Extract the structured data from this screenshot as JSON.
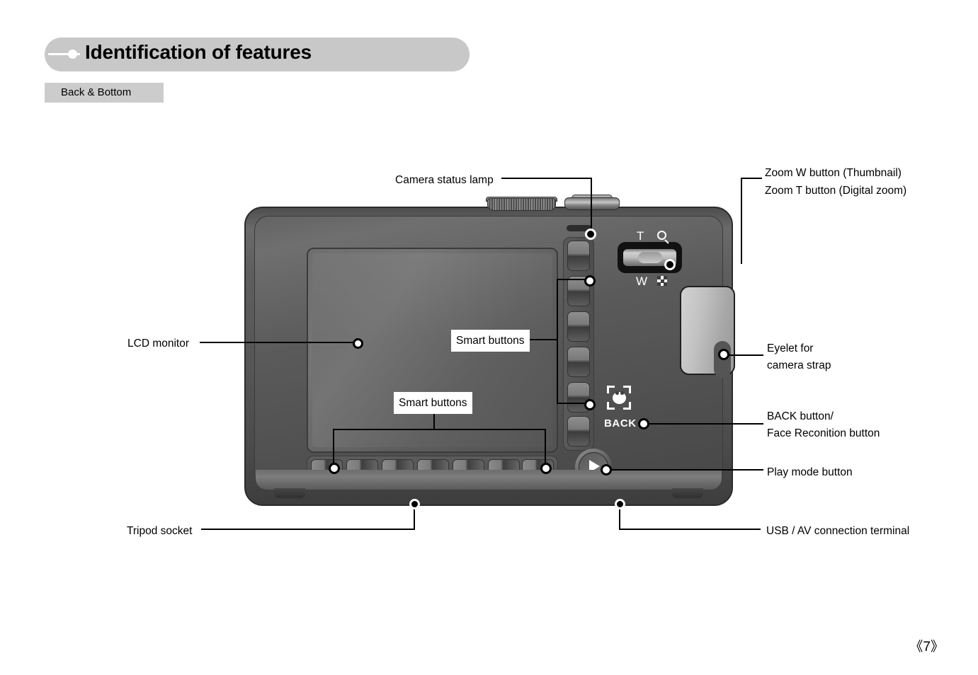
{
  "header": {
    "title": "Identification of features",
    "subtab": "Back & Bottom"
  },
  "callouts": {
    "camera_status_lamp": "Camera status lamp",
    "zoom_w": "Zoom W button (Thumbnail)",
    "zoom_t": "Zoom T button (Digital zoom)",
    "lcd_monitor": "LCD monitor",
    "smart_buttons_right": "Smart buttons",
    "smart_buttons_bottom": "Smart buttons",
    "eyelet_line1": "Eyelet for",
    "eyelet_line2": "camera strap",
    "back_button_line1": "BACK button/",
    "back_button_line2": "Face Reconition button",
    "play_mode_button": "Play mode button",
    "tripod_socket": "Tripod socket",
    "usb_av": "USB / AV connection terminal"
  },
  "camera_markings": {
    "zoom_t": "T",
    "zoom_w": "W",
    "back": "BACK",
    "magnifier_icon": "magnifier-icon",
    "thumbnail_icon": "thumbnail-grid-icon",
    "face_icon": "face-recognition-icon",
    "play_icon": "play-triangle-icon"
  },
  "footer": {
    "page_number": "《7》"
  },
  "colors": {
    "header_pill": "#c8c8c8",
    "subtab": "#cccccc",
    "body_bg": "#ffffff",
    "camera_body": "#555555",
    "eyelet": "#c2c2c2"
  }
}
